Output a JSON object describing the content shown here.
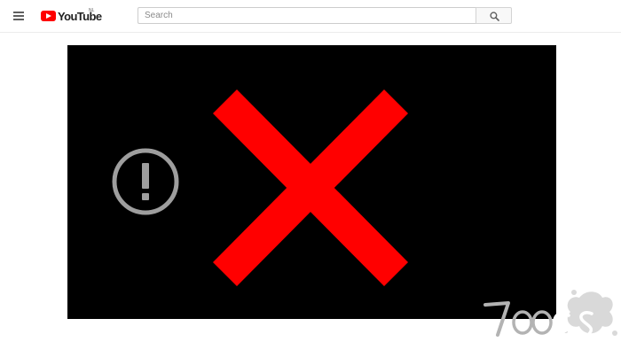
{
  "header": {
    "logo_text": "YouTube",
    "region_code": "NL",
    "search": {
      "placeholder": "Search",
      "value": ""
    },
    "icons": {
      "menu": "hamburger-menu-icon",
      "search": "search-icon"
    }
  },
  "player": {
    "state": "error",
    "icons": {
      "error": "exclamation-circle-icon",
      "blocked": "red-x-icon"
    }
  },
  "watermark": {
    "text": "7oocs"
  },
  "colors": {
    "brand_red": "#ff0000",
    "player_bg": "#000000",
    "error_icon": "#9e9e9e",
    "header_bg": "#ffffff"
  }
}
